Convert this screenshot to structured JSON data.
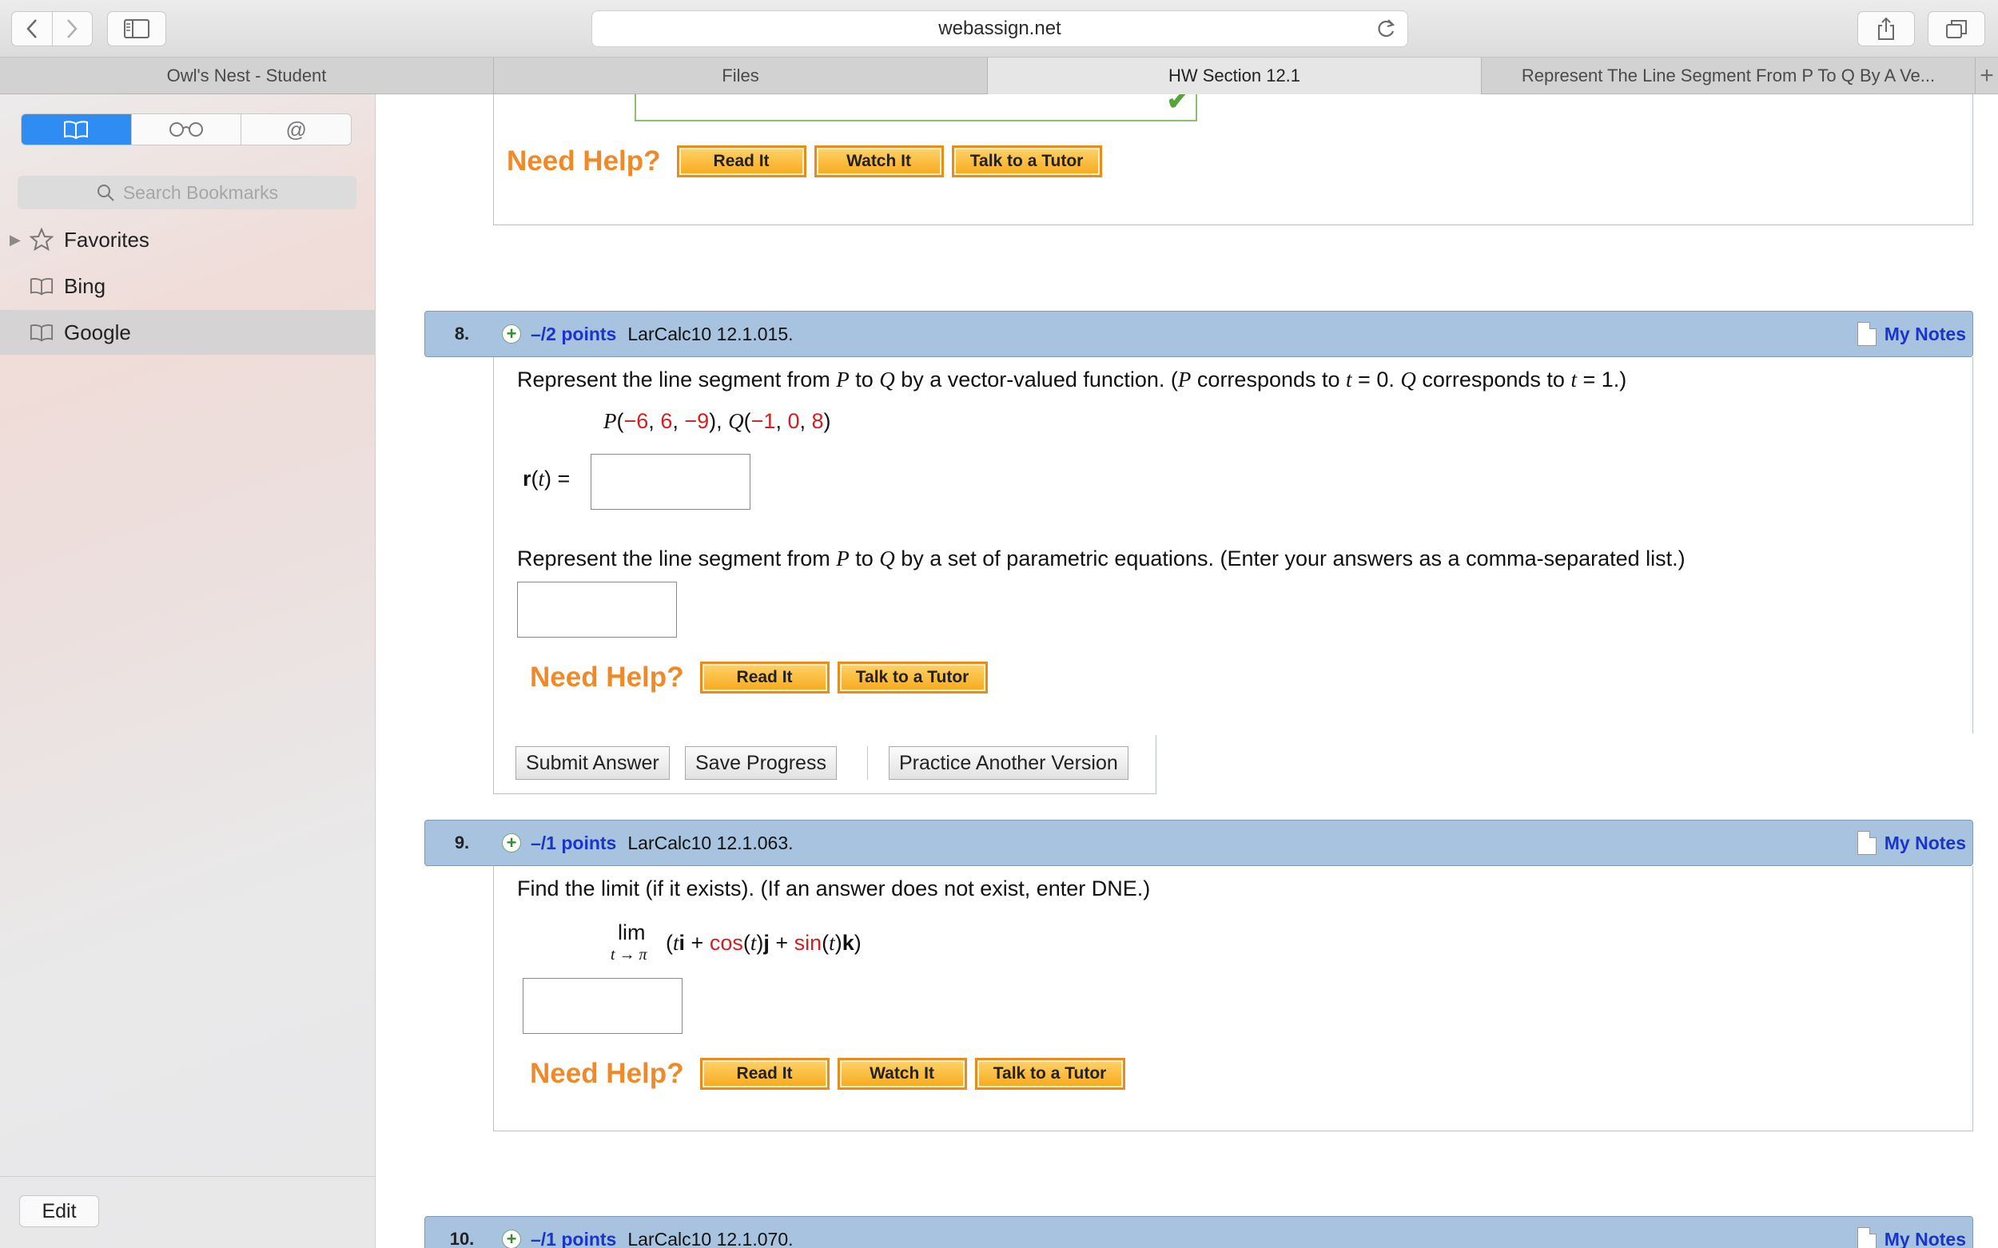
{
  "browser": {
    "url": "webassign.net",
    "tabs": [
      {
        "label": "Owl's Nest - Student",
        "active": false
      },
      {
        "label": "Files",
        "active": false
      },
      {
        "label": "HW Section 12.1",
        "active": true
      },
      {
        "label": "Represent The Line Segment From P To Q By A Ve...",
        "active": false
      }
    ],
    "new_tab_label": "+"
  },
  "sidebar": {
    "search_placeholder": "Search Bookmarks",
    "items": [
      {
        "label": "Favorites",
        "icon": "star-icon"
      },
      {
        "label": "Bing",
        "icon": "book-icon"
      },
      {
        "label": "Google",
        "icon": "book-icon",
        "selected": true
      }
    ],
    "edit_label": "Edit"
  },
  "help": {
    "need_help": "Need Help?",
    "read_it": "Read It",
    "watch_it": "Watch It",
    "talk_to_tutor": "Talk to a Tutor"
  },
  "questions": [
    {
      "number": "8.",
      "points": "–/2 points",
      "code": "LarCalc10 12.1.015.",
      "notes": "My Notes",
      "prompt_1": "Represent the line segment from P to Q by a vector-valued function. (P corresponds to t = 0. Q corresponds to t = 1.)",
      "points_text": "P(−6, 6, −9), Q(−1, 0, 8)",
      "r_label": "r(t) =",
      "prompt_2": "Represent the line segment from P to Q by a set of parametric equations. (Enter your answers as a comma-separated list.)",
      "actions": {
        "submit": "Submit Answer",
        "save": "Save Progress",
        "practice": "Practice Another Version"
      }
    },
    {
      "number": "9.",
      "points": "–/1 points",
      "code": "LarCalc10 12.1.063.",
      "notes": "My Notes",
      "prompt": "Find the limit (if it exists). (If an answer does not exist, enter DNE.)",
      "lim": "lim",
      "lim_sub": "t → π",
      "expression": "(ti + cos(t)j + sin(t)k)"
    },
    {
      "number": "10.",
      "points": "–/1 points",
      "code": "LarCalc10 12.1.070.",
      "notes": "My Notes"
    }
  ],
  "colors": {
    "accent_blue": "#2f8cf2",
    "header_blue": "#a7c3df",
    "help_orange": "#f08a28",
    "link_blue": "#1a35c8",
    "math_red": "#d22020"
  }
}
